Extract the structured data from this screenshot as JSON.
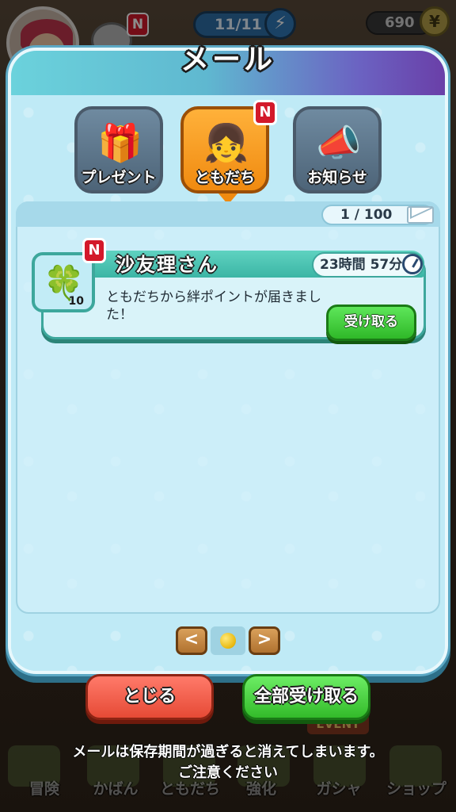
{
  "hud": {
    "notification_badge": "N",
    "stamina": "11/11",
    "stamina_icon": "lightning-icon",
    "coins": "690",
    "coin_icon": "yen-coin-icon"
  },
  "dialog": {
    "title": "メール",
    "tabs": [
      {
        "label": "プレゼント",
        "icon": "gift-icon",
        "active": false
      },
      {
        "label": "ともだち",
        "icon": "friend-icon",
        "active": true,
        "badge": "N"
      },
      {
        "label": "お知らせ",
        "icon": "megaphone-icon",
        "active": false
      }
    ],
    "counter": "1 / 100",
    "mail_items": [
      {
        "badge": "N",
        "item_icon": "clover-icon",
        "item_qty": "10",
        "sender": "沙友理さん",
        "timer": "23時間 57分",
        "message": "ともだちから絆ポイントが届きました！",
        "receive_label": "受け取る"
      }
    ],
    "pagination": {
      "prev": "<",
      "next": ">"
    },
    "close_label": "とじる",
    "receive_all_label": "全部受け取る"
  },
  "notice": {
    "line1": "メールは保存期間が過ぎると消えてしまいます。",
    "line2": "ご注意ください"
  },
  "event_tag": "EVENT",
  "nav": {
    "items": [
      "冒険",
      "かばん",
      "ともだち",
      "強化",
      "ガシャ",
      "ショップ"
    ]
  },
  "colors": {
    "panel_bg": "#bfeaf6",
    "active_tab": "#f08a10",
    "badge_red": "#d3192a",
    "green_button": "#33bb2a",
    "red_button": "#e64a36"
  }
}
